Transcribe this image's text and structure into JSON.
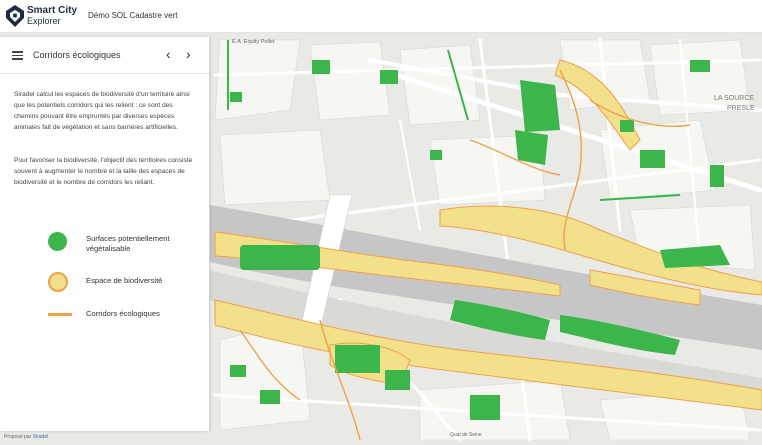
{
  "header": {
    "brand_line1": "Smart City",
    "brand_line2": "Explorer",
    "demo_title": "Démo SOL Cadastre vert"
  },
  "panel": {
    "title": "Corridors écologiques",
    "paragraph1": "Siradel calcul les espaces de biodiversité d'un territoire ainsi que les potentiels corridors qui les relient : ce sont des chemins pouvant être empruntés par diverses espèces animales fait de végétation et sans barrières artificielles.",
    "paragraph2": "Pour favoriser la biodiversité, l'objectif des territoires consiste souvent à augmenter le nombre et la taille des espaces de biodiversité et le nombre de corridors les reliant.",
    "legend": [
      {
        "label": "Surfaces potentiellement végétalisable",
        "symbol": "green-circle",
        "color": "#3cb54a"
      },
      {
        "label": "Espace de biodiversité",
        "symbol": "yellow-circle",
        "color": "#f2e08a"
      },
      {
        "label": "Corridors écologiques",
        "symbol": "orange-line",
        "color": "#f0a04a"
      }
    ]
  },
  "map": {
    "labels": {
      "top_label": "E.A. Equity Pollet",
      "area_label_1": "LA SOURCE",
      "area_label_2": "PRESLE",
      "bottom_label": "Quai de Seine"
    }
  },
  "attribution": {
    "prefix": "Proposé par",
    "link": "Siradel"
  },
  "colors": {
    "vegetation": "#3cb54a",
    "biodiversity": "#f2e08a",
    "corridor": "#f0a04a",
    "river": "#c6c6c6",
    "background": "#e9e9e6"
  }
}
